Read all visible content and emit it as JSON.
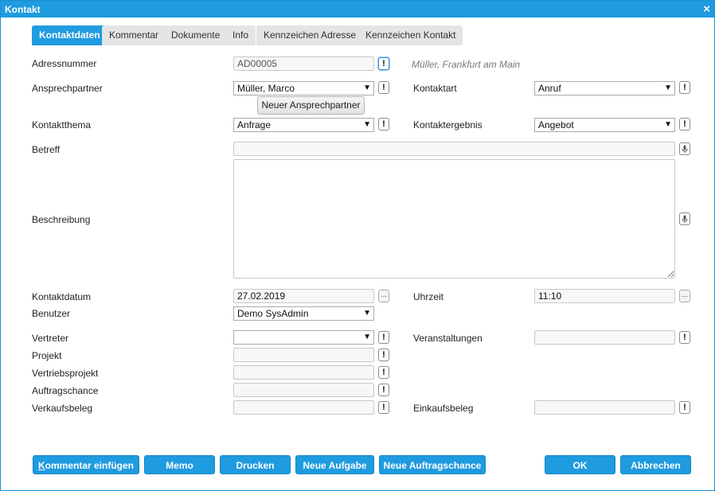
{
  "window": {
    "title": "Kontakt",
    "close_glyph": "×"
  },
  "tabs": [
    {
      "label": "Kontaktdaten",
      "active": true
    },
    {
      "label": "Kommentar"
    },
    {
      "label": "Dokumente"
    },
    {
      "label": "Info"
    },
    {
      "label": "Kennzeichen Adresse"
    },
    {
      "label": "Kennzeichen Kontakt"
    }
  ],
  "fields": {
    "adressnummer": {
      "label": "Adressnummer",
      "value": "AD00005",
      "hint": "Müller, Frankfurt am Main"
    },
    "ansprechpartner": {
      "label": "Ansprechpartner",
      "value": "Müller, Marco",
      "new_button": "Neuer Ansprechpartner"
    },
    "kontaktart": {
      "label": "Kontaktart",
      "value": "Anruf"
    },
    "kontaktthema": {
      "label": "Kontaktthema",
      "value": "Anfrage"
    },
    "kontaktergebnis": {
      "label": "Kontaktergebnis",
      "value": "Angebot"
    },
    "betreff": {
      "label": "Betreff",
      "value": ""
    },
    "beschreibung": {
      "label": "Beschreibung",
      "value": ""
    },
    "kontaktdatum": {
      "label": "Kontaktdatum",
      "value": "27.02.2019"
    },
    "uhrzeit": {
      "label": "Uhrzeit",
      "value": "11:10"
    },
    "benutzer": {
      "label": "Benutzer",
      "value": "Demo SysAdmin"
    },
    "vertreter": {
      "label": "Vertreter",
      "value": ""
    },
    "veranstaltungen": {
      "label": "Veranstaltungen",
      "value": ""
    },
    "projekt": {
      "label": "Projekt",
      "value": ""
    },
    "vertriebsprojekt": {
      "label": "Vertriebsprojekt",
      "value": ""
    },
    "auftragschance": {
      "label": "Auftragschance",
      "value": ""
    },
    "verkaufsbeleg": {
      "label": "Verkaufsbeleg",
      "value": ""
    },
    "einkaufsbeleg": {
      "label": "Einkaufsbeleg",
      "value": ""
    }
  },
  "glyphs": {
    "info": "!",
    "dots": "...",
    "dropdown": "▼"
  },
  "buttons": {
    "kommentar_first": "K",
    "kommentar_rest": "ommentar einfügen",
    "memo": "Memo",
    "drucken": "Drucken",
    "neue_aufgabe": "Neue Aufgabe",
    "neue_auftragschance": "Neue Auftragschance",
    "ok": "OK",
    "abbrechen": "Abbrechen"
  },
  "colors": {
    "accent": "#1f9be0",
    "tab_inactive": "#e4e4e4",
    "field_bg": "#f7f7f7"
  },
  "icons": {
    "close": "close-icon",
    "info": "exclamation-icon",
    "mic": "microphone-icon",
    "calendar": "ellipsis-icon"
  }
}
